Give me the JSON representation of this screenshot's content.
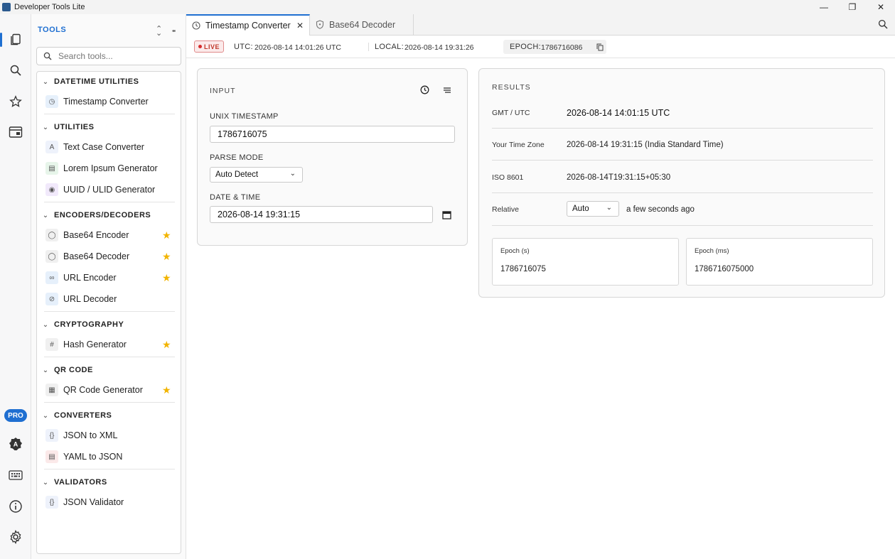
{
  "window": {
    "title": "Developer Tools Lite"
  },
  "activity": {
    "pro_label": "PRO"
  },
  "sidebar": {
    "title": "TOOLS",
    "search_placeholder": "Search tools...",
    "groups": [
      {
        "label": "DATETIME UTILITIES",
        "items": [
          {
            "label": "Timestamp Converter",
            "icon": "clock-icon",
            "starred": false
          }
        ]
      },
      {
        "label": "UTILITIES",
        "items": [
          {
            "label": "Text Case Converter",
            "icon": "text-case-icon",
            "starred": false
          },
          {
            "label": "Lorem Ipsum Generator",
            "icon": "document-icon",
            "starred": false
          },
          {
            "label": "UUID / ULID Generator",
            "icon": "fingerprint-icon",
            "starred": false
          }
        ]
      },
      {
        "label": "ENCODERS/DECODERS",
        "items": [
          {
            "label": "Base64 Encoder",
            "icon": "shield-icon",
            "starred": true
          },
          {
            "label": "Base64 Decoder",
            "icon": "shield-icon",
            "starred": true
          },
          {
            "label": "URL Encoder",
            "icon": "link-icon",
            "starred": true
          },
          {
            "label": "URL Decoder",
            "icon": "link-off-icon",
            "starred": false
          }
        ]
      },
      {
        "label": "CRYPTOGRAPHY",
        "items": [
          {
            "label": "Hash Generator",
            "icon": "hash-icon",
            "starred": true
          }
        ]
      },
      {
        "label": "QR CODE",
        "items": [
          {
            "label": "QR Code Generator",
            "icon": "qr-code-icon",
            "starred": true
          }
        ]
      },
      {
        "label": "CONVERTERS",
        "items": [
          {
            "label": "JSON to XML",
            "icon": "braces-icon",
            "starred": false
          },
          {
            "label": "YAML to JSON",
            "icon": "file-icon",
            "starred": false
          }
        ]
      },
      {
        "label": "VALIDATORS",
        "items": [
          {
            "label": "JSON Validator",
            "icon": "braces-icon",
            "starred": false
          }
        ]
      }
    ]
  },
  "tabs": [
    {
      "label": "Timestamp Converter",
      "active": true
    },
    {
      "label": "Base64 Decoder",
      "active": false
    }
  ],
  "status": {
    "live_label": "LIVE",
    "utc_label": "UTC:",
    "utc_value": "2026-08-14 14:01:26 UTC",
    "local_label": "LOCAL:",
    "local_value": "2026-08-14 19:31:26",
    "epoch_label": "EPOCH:",
    "epoch_value": "1786716086"
  },
  "input": {
    "title": "INPUT",
    "unix_label": "UNIX TIMESTAMP",
    "unix_value": "1786716075",
    "parse_label": "PARSE MODE",
    "parse_value": "Auto Detect",
    "datetime_label": "DATE & TIME",
    "datetime_value": "2026-08-14 19:31:15"
  },
  "results": {
    "title": "RESULTS",
    "gmt_label": "GMT / UTC",
    "gmt_value": "2026-08-14 14:01:15 UTC",
    "tz_label": "Your Time Zone",
    "tz_value": "2026-08-14 19:31:15 (India Standard Time)",
    "iso_label": "ISO 8601",
    "iso_value": "2026-08-14T19:31:15+05:30",
    "relative_label": "Relative",
    "relative_mode": "Auto",
    "relative_value": "a few seconds ago",
    "epoch_s_label": "Epoch (s)",
    "epoch_s_value": "1786716075",
    "epoch_ms_label": "Epoch (ms)",
    "epoch_ms_value": "1786716075000"
  },
  "colors": {
    "accent": "#1f6fd1",
    "star": "#f2b400",
    "live": "#c0392b"
  }
}
